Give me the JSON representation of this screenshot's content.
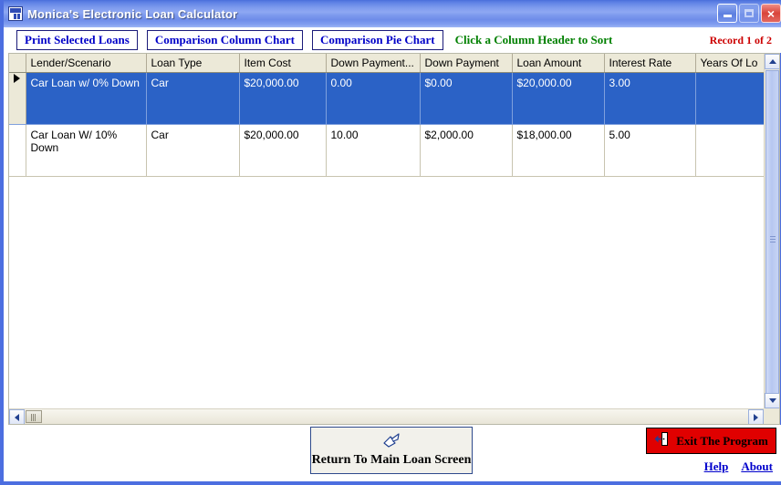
{
  "window": {
    "title": "Monica's Electronic Loan Calculator",
    "icon": "app-icon",
    "minimize_label": "",
    "maximize_label": "",
    "close_label": "×"
  },
  "toolbar": {
    "print_selected_loans": "Print Selected Loans",
    "comparison_column_chart": "Comparison Column Chart",
    "comparison_pie_chart": "Comparison Pie Chart",
    "sort_hint": "Click a Column Header to Sort",
    "record_status": "Record 1 of 2",
    "hint_color": "#008000",
    "record_color": "#cc0000",
    "button_text_color": "#0000c8"
  },
  "grid": {
    "columns": [
      "Lender/Scenario",
      "Loan Type",
      "Item Cost",
      "Down Payment...",
      "Down Payment",
      "Loan Amount",
      "Interest Rate",
      "Years Of Lo"
    ],
    "rows": [
      {
        "selected": true,
        "marker": "current-record-arrow",
        "cells": [
          "Car Loan w/ 0% Down",
          "Car",
          "$20,000.00",
          "0.00",
          "$0.00",
          "$20,000.00",
          "3.00",
          ""
        ]
      },
      {
        "selected": false,
        "marker": "",
        "cells": [
          "Car Loan W/ 10% Down",
          "Car",
          "$20,000.00",
          "10.00",
          "$2,000.00",
          "$18,000.00",
          "5.00",
          ""
        ]
      }
    ],
    "selection_color": "#2b62c6",
    "header_color": "#ece9d8",
    "empty_area_color": "#00c853"
  },
  "footer": {
    "return_button": "Return To Main Loan Screen",
    "return_icon": "pointing-hand-icon",
    "exit_button": "Exit The Program",
    "exit_icon": "exit-door-icon",
    "exit_color": "#e00000",
    "help_link": "Help",
    "about_link": "About"
  }
}
